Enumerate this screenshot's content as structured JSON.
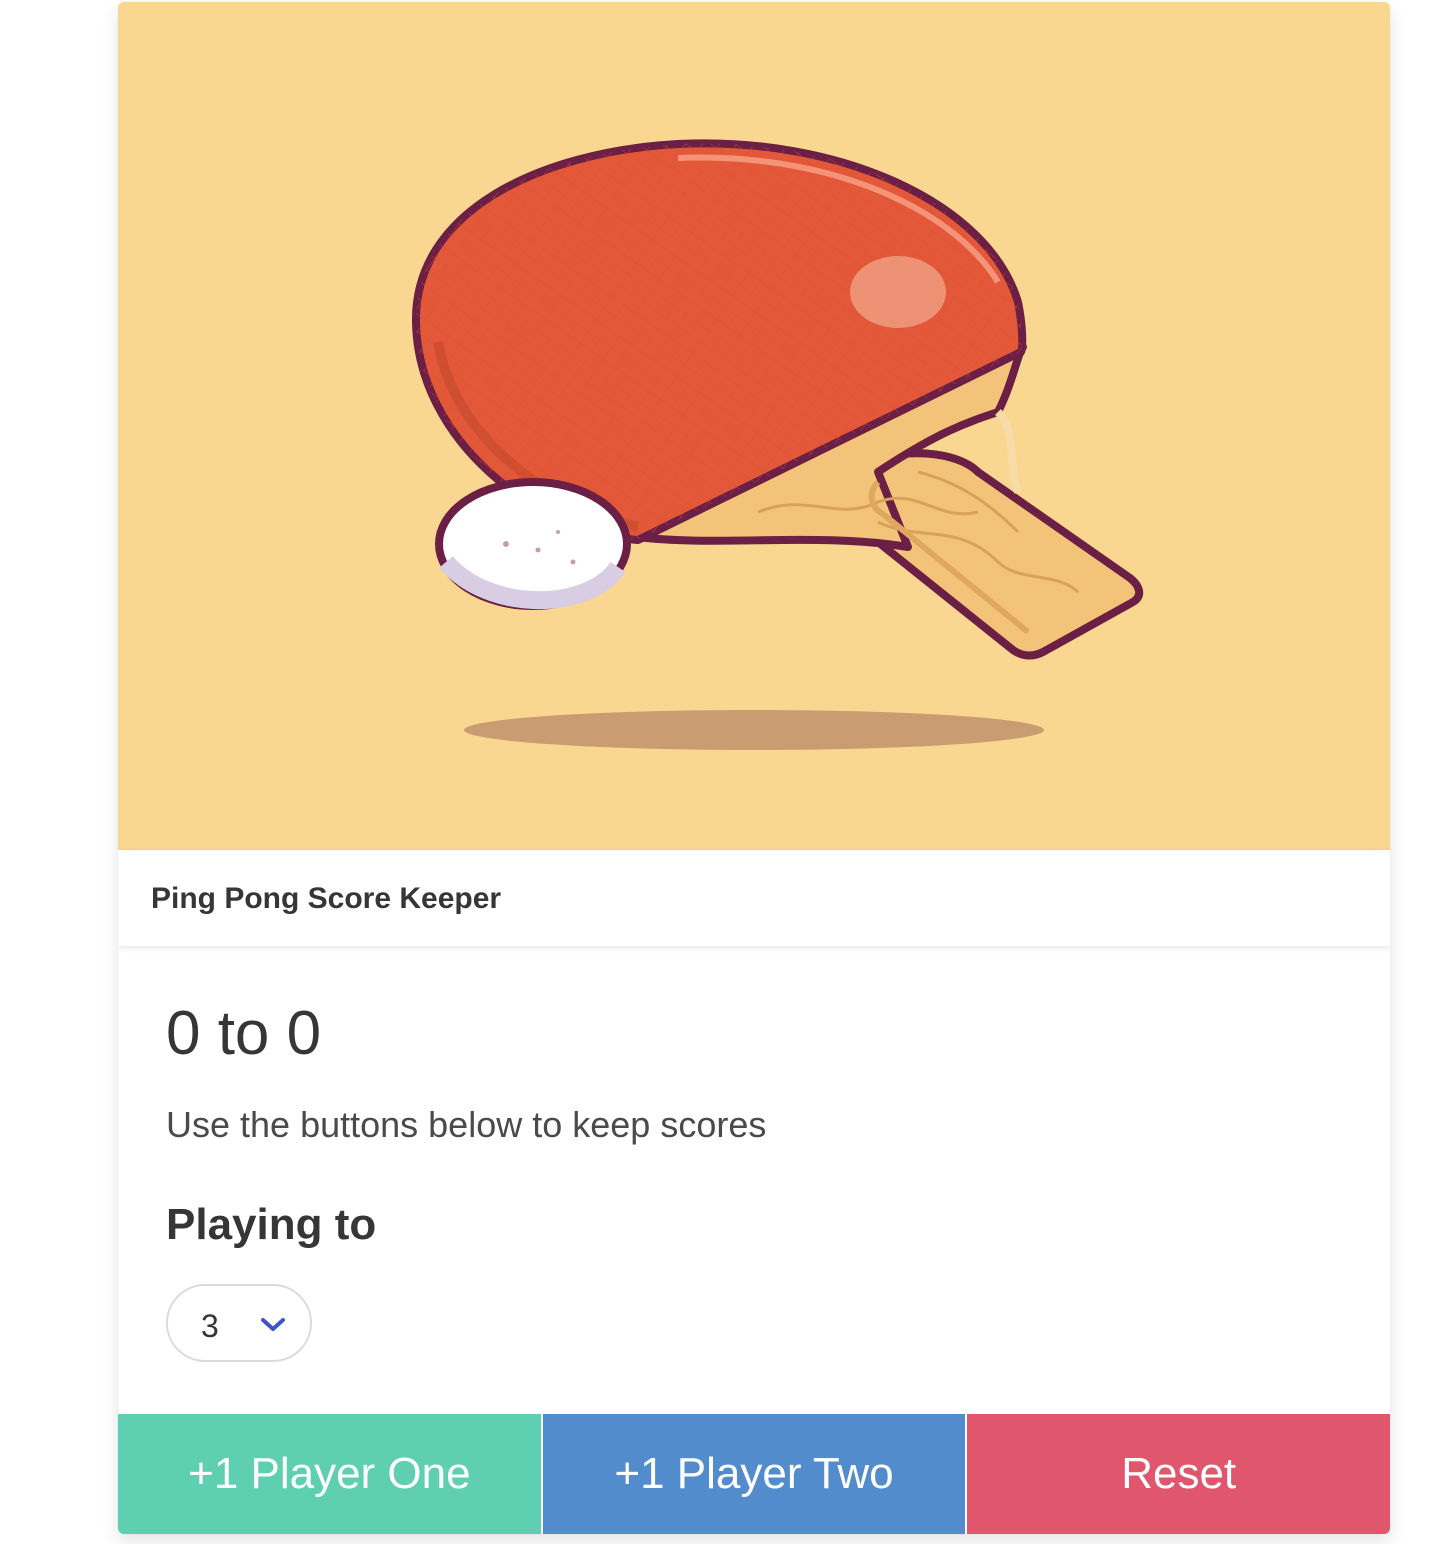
{
  "card": {
    "header_title": "Ping Pong Score Keeper",
    "image_icon": "ping-pong-paddle-illustration"
  },
  "score": {
    "text": "0 to 0"
  },
  "instructions": "Use the buttons below to keep scores",
  "playing_to": {
    "label": "Playing to",
    "selected": "3",
    "icon": "chevron-down-icon"
  },
  "footer": {
    "player_one_label": "+1 Player One",
    "player_two_label": "+1 Player Two",
    "reset_label": "Reset"
  },
  "colors": {
    "image_bg": "#f9d791",
    "player_one": "#5fcfb1",
    "player_two": "#528ccc",
    "reset": "#e0566c",
    "chevron": "#3e56c4"
  }
}
